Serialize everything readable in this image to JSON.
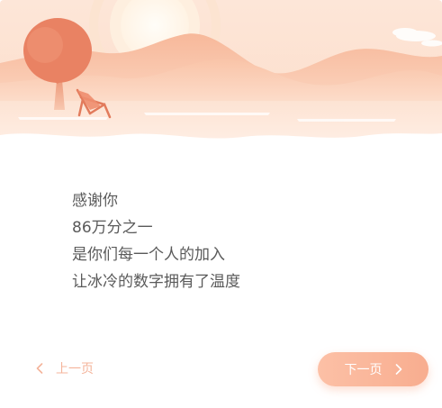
{
  "message": {
    "lines": [
      "感谢你",
      "86万分之一",
      "是你们每一个人的加入",
      "让冰冷的数字拥有了温度"
    ]
  },
  "nav": {
    "prev_label": "上一页",
    "next_label": "下一页"
  },
  "colors": {
    "accent": "#f8ad8f",
    "accent_light": "#fcc0a6",
    "text": "#5a5a5a",
    "prev_text": "#f4b49b"
  },
  "icons": {
    "prev": "chevron-left-icon",
    "next": "chevron-right-icon"
  }
}
